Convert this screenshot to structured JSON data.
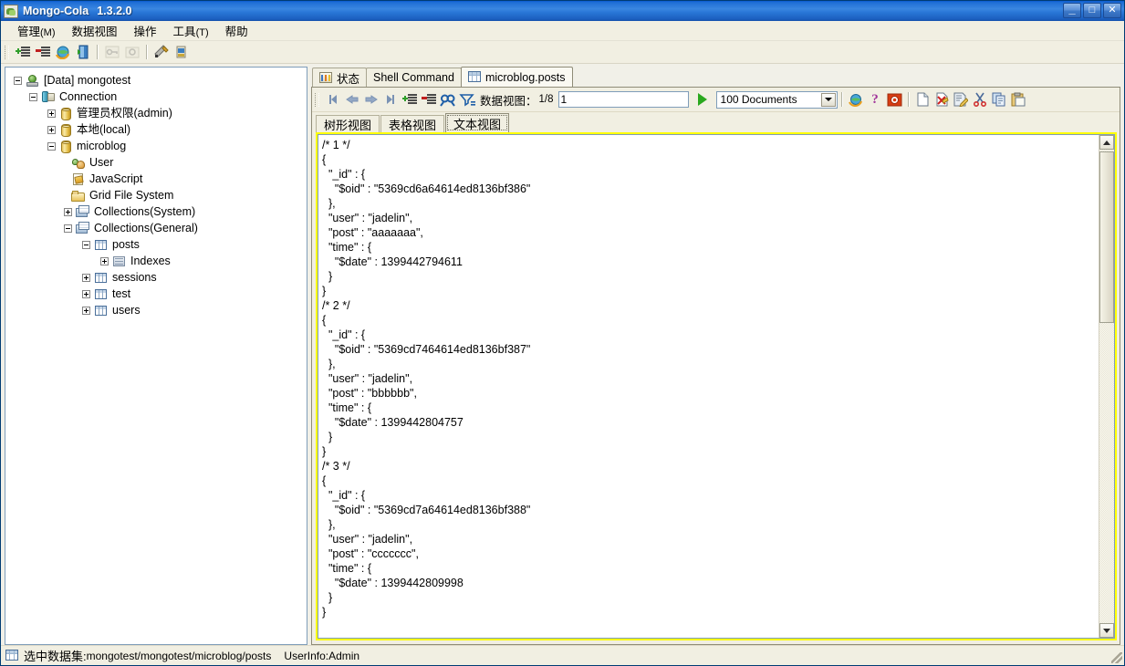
{
  "window": {
    "title": "Mongo-Cola",
    "version": "1.3.2.0",
    "icon": "app-icon",
    "minimize": "_",
    "maximize": "□",
    "close": "✕"
  },
  "menubar": {
    "items": [
      {
        "label": "管理",
        "mnemonic": "(M)"
      },
      {
        "label": "数据视图",
        "mnemonic": ""
      },
      {
        "label": "操作",
        "mnemonic": ""
      },
      {
        "label": "工具",
        "mnemonic": "(T)"
      },
      {
        "label": "帮助",
        "mnemonic": ""
      }
    ]
  },
  "toolbar": {
    "items": [
      {
        "name": "add-connection-icon",
        "enabled": true
      },
      {
        "name": "remove-connection-icon",
        "enabled": true
      },
      {
        "name": "refresh-globe-icon",
        "enabled": true
      },
      {
        "name": "exit-door-icon",
        "enabled": true
      },
      {
        "name": "key-icon",
        "enabled": false
      },
      {
        "name": "camera-icon",
        "enabled": false
      },
      {
        "name": "tools-icon",
        "enabled": true
      },
      {
        "name": "import-export-icon",
        "enabled": true
      }
    ]
  },
  "tree": {
    "nodes": [
      {
        "label": "[Data] mongotest",
        "depth": 0,
        "expander": "minus",
        "icon": "data-server-icon"
      },
      {
        "label": "Connection",
        "depth": 1,
        "expander": "minus",
        "icon": "connection-icon"
      },
      {
        "label": "管理员权限(admin)",
        "depth": 2,
        "expander": "plus",
        "icon": "database-icon"
      },
      {
        "label": "本地(local)",
        "depth": 2,
        "expander": "plus",
        "icon": "database-icon"
      },
      {
        "label": "microblog",
        "depth": 2,
        "expander": "minus",
        "icon": "database-icon"
      },
      {
        "label": "User",
        "depth": 3,
        "expander": "none",
        "icon": "user-icon"
      },
      {
        "label": "JavaScript",
        "depth": 3,
        "expander": "none",
        "icon": "javascript-icon"
      },
      {
        "label": "Grid File System",
        "depth": 3,
        "expander": "none",
        "icon": "folder-icon"
      },
      {
        "label": "Collections(System)",
        "depth": 3,
        "expander": "plus",
        "icon": "collections-icon"
      },
      {
        "label": "Collections(General)",
        "depth": 3,
        "expander": "minus",
        "icon": "collections-icon"
      },
      {
        "label": "posts",
        "depth": 4,
        "expander": "minus",
        "icon": "table-icon"
      },
      {
        "label": "Indexes",
        "depth": 5,
        "expander": "plus",
        "icon": "index-icon"
      },
      {
        "label": "sessions",
        "depth": 4,
        "expander": "plus",
        "icon": "table-icon"
      },
      {
        "label": "test",
        "depth": 4,
        "expander": "plus",
        "icon": "table-icon"
      },
      {
        "label": "users",
        "depth": 4,
        "expander": "plus",
        "icon": "table-icon"
      }
    ]
  },
  "tabs": {
    "items": [
      {
        "label": "状态",
        "icon": "chart-icon",
        "active": false
      },
      {
        "label": "Shell Command",
        "icon": "none",
        "active": false
      },
      {
        "label": "microblog.posts",
        "icon": "grid-icon",
        "active": true
      }
    ]
  },
  "data_toolbar": {
    "nav": {
      "first": "first-page-icon",
      "previous": "previous-page-icon",
      "next": "next-page-icon",
      "last": "last-page-icon"
    },
    "add_label": "add-record-icon",
    "remove_label": "remove-record-icon",
    "find_label": "find-icon",
    "filter_label": "filter-icon",
    "dataview_label": "数据视图：",
    "page_fraction": "1/8",
    "page_value": "1",
    "go_label": "go-button",
    "doc_count": "100 Documents",
    "icons": [
      {
        "name": "globe-icon"
      },
      {
        "name": "help-icon"
      },
      {
        "name": "record-icon"
      },
      {
        "name": "new-document-icon"
      },
      {
        "name": "delete-document-icon"
      },
      {
        "name": "edit-document-icon"
      },
      {
        "name": "cut-icon"
      },
      {
        "name": "copy-icon"
      },
      {
        "name": "paste-icon"
      }
    ]
  },
  "view_tabs": {
    "items": [
      {
        "label": "树形视图",
        "active": false
      },
      {
        "label": "表格视图",
        "active": false
      },
      {
        "label": "文本视图",
        "active": true
      }
    ]
  },
  "document_text": "/* 1 */\n{\n  \"_id\" : {\n    \"$oid\" : \"5369cd6a64614ed8136bf386\"\n  },\n  \"user\" : \"jadelin\",\n  \"post\" : \"aaaaaaa\",\n  \"time\" : {\n    \"$date\" : 1399442794611\n  }\n}\n/* 2 */\n{\n  \"_id\" : {\n    \"$oid\" : \"5369cd7464614ed8136bf387\"\n  },\n  \"user\" : \"jadelin\",\n  \"post\" : \"bbbbbb\",\n  \"time\" : {\n    \"$date\" : 1399442804757\n  }\n}\n/* 3 */\n{\n  \"_id\" : {\n    \"$oid\" : \"5369cd7a64614ed8136bf388\"\n  },\n  \"user\" : \"jadelin\",\n  \"post\" : \"ccccccc\",\n  \"time\" : {\n    \"$date\" : 1399442809998\n  }\n}",
  "documents": [
    {
      "index": "1",
      "oid": "5369cd6a64614ed8136bf386",
      "user": "jadelin",
      "post": "aaaaaaa",
      "date": "1399442794611"
    },
    {
      "index": "2",
      "oid": "5369cd7464614ed8136bf387",
      "user": "jadelin",
      "post": "bbbbbb",
      "date": "1399442804757"
    },
    {
      "index": "3",
      "oid": "5369cd7a64614ed8136bf388",
      "user": "jadelin",
      "post": "ccccccc",
      "date": "1399442809998"
    }
  ],
  "statusbar": {
    "selected_label": "选中数据集:",
    "selected_path": "mongotest/mongotest/microblog/posts",
    "user_info": "UserInfo:Admin"
  },
  "colors": {
    "title_bar": "#2a78d8",
    "highlight_border": "#ffff00",
    "panel_bg": "#f1efe2",
    "tree_bg": "#ffffff",
    "go_green": "#2aa81e"
  }
}
